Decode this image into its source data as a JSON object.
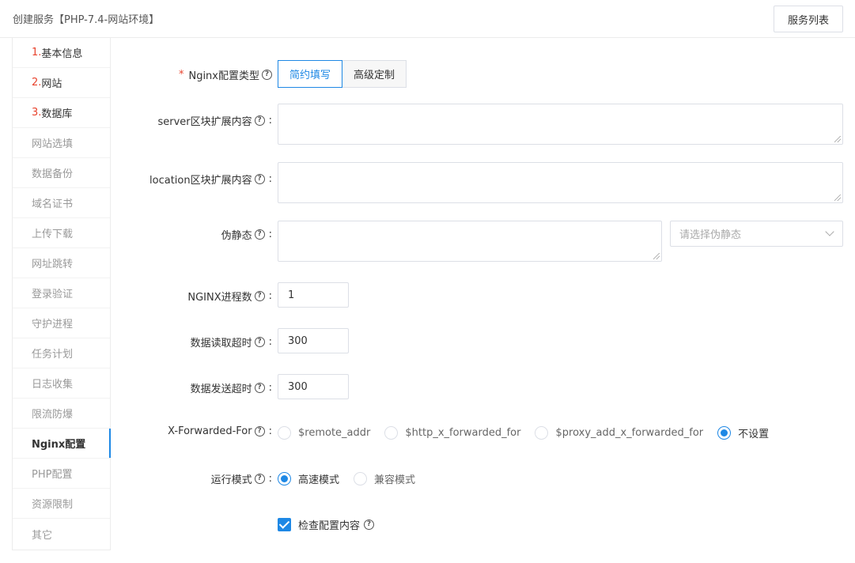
{
  "header": {
    "title": "创建服务【PHP-7.4-网站环境】",
    "list_button": "服务列表"
  },
  "sidebar": {
    "items": [
      {
        "num": "1.",
        "label": "基本信息"
      },
      {
        "num": "2.",
        "label": "网站"
      },
      {
        "num": "3.",
        "label": "数据库"
      },
      {
        "num": "",
        "label": "网站选填"
      },
      {
        "num": "",
        "label": "数据备份"
      },
      {
        "num": "",
        "label": "域名证书"
      },
      {
        "num": "",
        "label": "上传下载"
      },
      {
        "num": "",
        "label": "网址跳转"
      },
      {
        "num": "",
        "label": "登录验证"
      },
      {
        "num": "",
        "label": "守护进程"
      },
      {
        "num": "",
        "label": "任务计划"
      },
      {
        "num": "",
        "label": "日志收集"
      },
      {
        "num": "",
        "label": "限流防爆"
      },
      {
        "num": "",
        "label": "Nginx配置"
      },
      {
        "num": "",
        "label": "PHP配置"
      },
      {
        "num": "",
        "label": "资源限制"
      },
      {
        "num": "",
        "label": "其它"
      }
    ]
  },
  "form": {
    "nginx_type": {
      "label": "Nginx配置类型",
      "required_mark": "*",
      "options": [
        "简约填写",
        "高级定制"
      ],
      "selected": "简约填写"
    },
    "server_ext": {
      "label": "server区块扩展内容",
      "value": ""
    },
    "location_ext": {
      "label": "location区块扩展内容",
      "value": ""
    },
    "rewrite": {
      "label": "伪静态",
      "value": "",
      "select_placeholder": "请选择伪静态"
    },
    "worker_processes": {
      "label": "NGINX进程数",
      "value": "1"
    },
    "read_timeout": {
      "label": "数据读取超时",
      "value": "300"
    },
    "send_timeout": {
      "label": "数据发送超时",
      "value": "300"
    },
    "x_forwarded_for": {
      "label": "X-Forwarded-For",
      "options": [
        "$remote_addr",
        "$http_x_forwarded_for",
        "$proxy_add_x_forwarded_for",
        "不设置"
      ],
      "selected": "不设置"
    },
    "run_mode": {
      "label": "运行模式",
      "options": [
        "高速模式",
        "兼容模式"
      ],
      "selected": "高速模式"
    },
    "check_config": {
      "label": "检查配置内容",
      "checked": true
    }
  },
  "help_glyph": "?",
  "colon": ":",
  "colors": {
    "accent": "#1e88e5",
    "required": "#e8432d"
  }
}
